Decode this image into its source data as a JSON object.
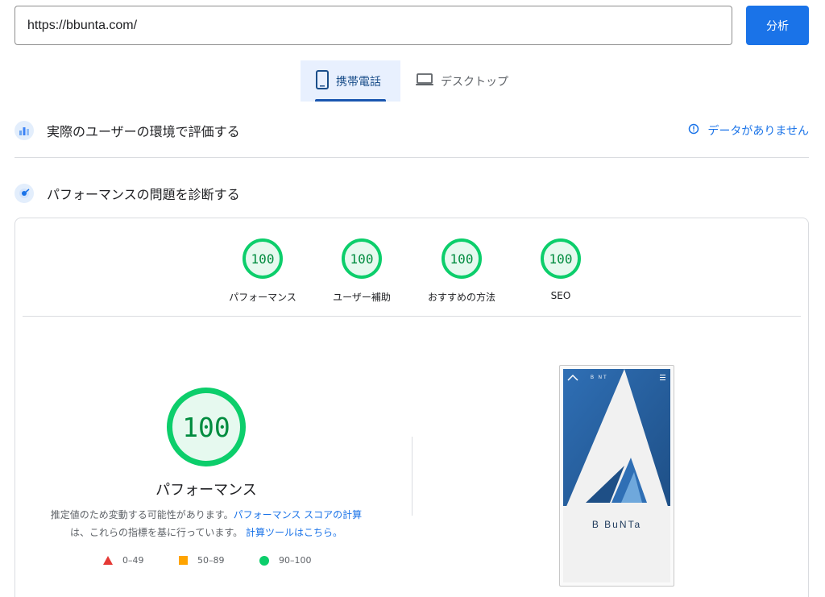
{
  "url_input": {
    "value": "https://bbunta.com/"
  },
  "analyze_button": {
    "label": "分析"
  },
  "tabs": [
    {
      "label": "携帯電話",
      "selected": true
    },
    {
      "label": "デスクトップ",
      "selected": false
    }
  ],
  "field_section": {
    "title": "実際のユーザーの環境で評価する",
    "status": "データがありません"
  },
  "lab_section": {
    "title": "パフォーマンスの問題を診断する"
  },
  "category_scores": [
    {
      "label": "パフォーマンス",
      "score": "100"
    },
    {
      "label": "ユーザー補助",
      "score": "100"
    },
    {
      "label": "おすすめの方法",
      "score": "100"
    },
    {
      "label": "SEO",
      "score": "100"
    }
  ],
  "performance": {
    "score": "100",
    "title": "パフォーマンス",
    "desc_text_1": "推定値のため変動する可能性があります。",
    "desc_link_1": "パフォーマンス スコアの計算",
    "desc_text_2": "は、これらの指標を基に行っています。",
    "desc_link_2": "計算ツールはこちら。"
  },
  "legend": [
    {
      "range": "0–49",
      "color": "#e53935",
      "shape": "triangle"
    },
    {
      "range": "50–89",
      "color": "#ffa400",
      "shape": "square"
    },
    {
      "range": "90–100",
      "color": "#0cce6b",
      "shape": "circle"
    }
  ],
  "preview": {
    "brand": "B BuNTa",
    "topbar": "B NT"
  },
  "colors": {
    "accent": "#1a73e8",
    "pass": "#0cce6b",
    "pass_text": "#008c3f"
  }
}
